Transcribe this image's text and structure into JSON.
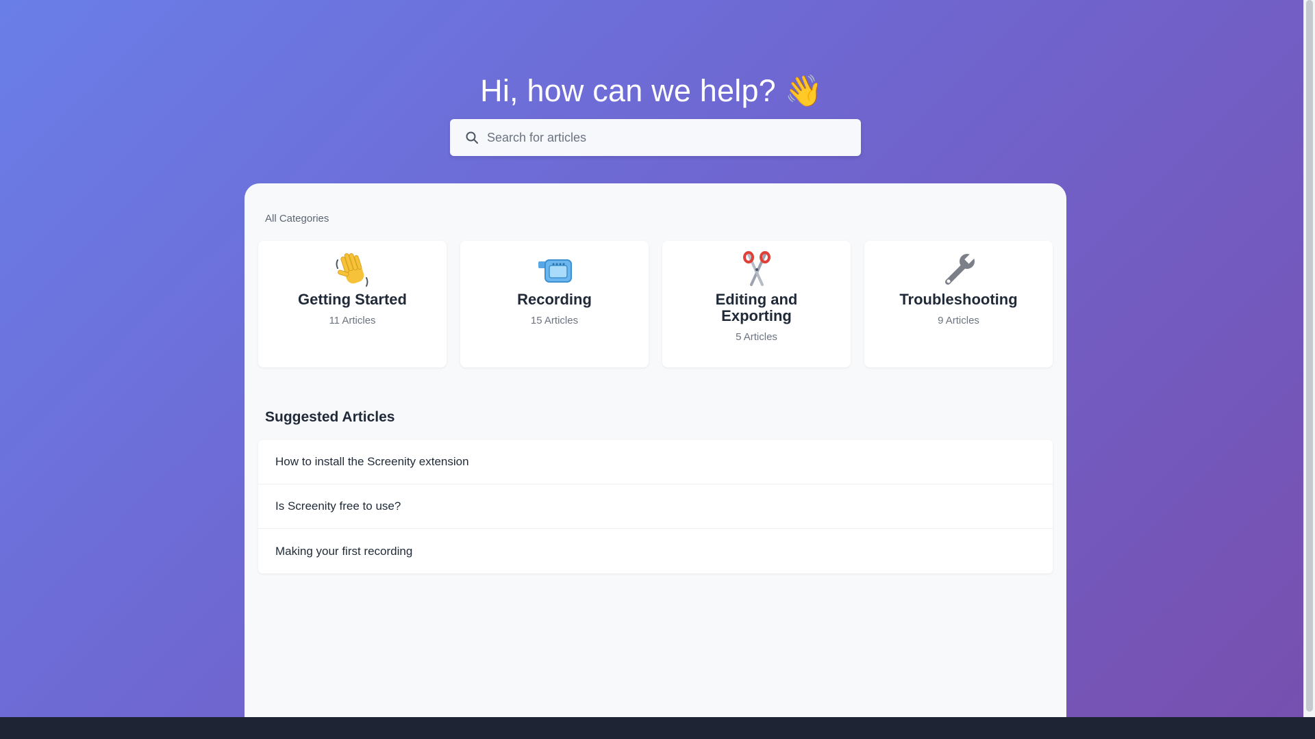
{
  "hero": {
    "title": "Hi, how can we help? 👋"
  },
  "search": {
    "placeholder": "Search for articles",
    "value": ""
  },
  "categories": {
    "label": "All Categories",
    "items": [
      {
        "icon": "waving-hand-icon",
        "title": "Getting Started",
        "count": "11 Articles"
      },
      {
        "icon": "video-camera-icon",
        "title": "Recording",
        "count": "15 Articles"
      },
      {
        "icon": "scissors-icon",
        "title": "Editing and Exporting",
        "count": "5 Articles"
      },
      {
        "icon": "wrench-icon",
        "title": "Troubleshooting",
        "count": "9 Articles"
      }
    ]
  },
  "suggested": {
    "heading": "Suggested Articles",
    "articles": [
      "How to install the Screenity extension",
      "Is Screenity free to use?",
      "Making your first recording"
    ]
  },
  "colors": {
    "gradient_start": "#6a7ee8",
    "gradient_end": "#774fae",
    "footer": "#1e2433"
  }
}
